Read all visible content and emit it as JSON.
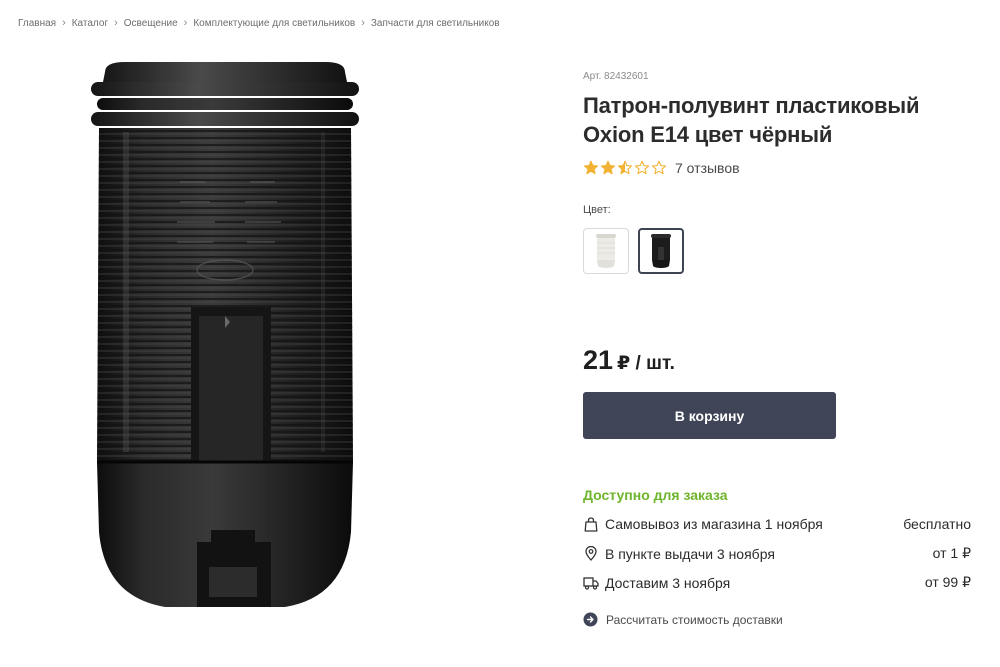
{
  "breadcrumb": [
    "Главная",
    "Каталог",
    "Освещение",
    "Комплектующие для светильников",
    "Запчасти для светильников"
  ],
  "product": {
    "sku": "Арт. 82432601",
    "title": "Патрон-полувинт пластиковый Oxion E14 цвет чёрный",
    "rating": 2.5,
    "rating_max": 5,
    "reviews": "7 отзывов",
    "image_icon": "lamp-socket-image"
  },
  "color": {
    "label": "Цвет:",
    "options": [
      {
        "name": "white",
        "color": "#ecebe6",
        "selected": false
      },
      {
        "name": "black",
        "color": "#1c1c1c",
        "selected": true
      }
    ]
  },
  "price": {
    "value": "21",
    "unit": "₽ / шт."
  },
  "cart": {
    "label": "В корзину"
  },
  "availability": {
    "label": "Доступно для заказа",
    "color": "#6fb52c"
  },
  "delivery": [
    {
      "icon": "shopping-bag-icon",
      "label": "Самовывоз из магазина 1 ноября",
      "price": "бесплатно"
    },
    {
      "icon": "map-pin-icon",
      "label": "В пункте выдачи 3 ноября",
      "price": "от 1 ₽"
    },
    {
      "icon": "truck-icon",
      "label": "Доставим 3 ноября",
      "price": "от 99 ₽"
    }
  ],
  "calc_link": {
    "label": "Рассчитать стоимость доставки",
    "icon": "arrow-circle-icon"
  },
  "colors": {
    "accent": "#3f4556",
    "star": "#f2b233",
    "star_empty": "#f2b233"
  }
}
